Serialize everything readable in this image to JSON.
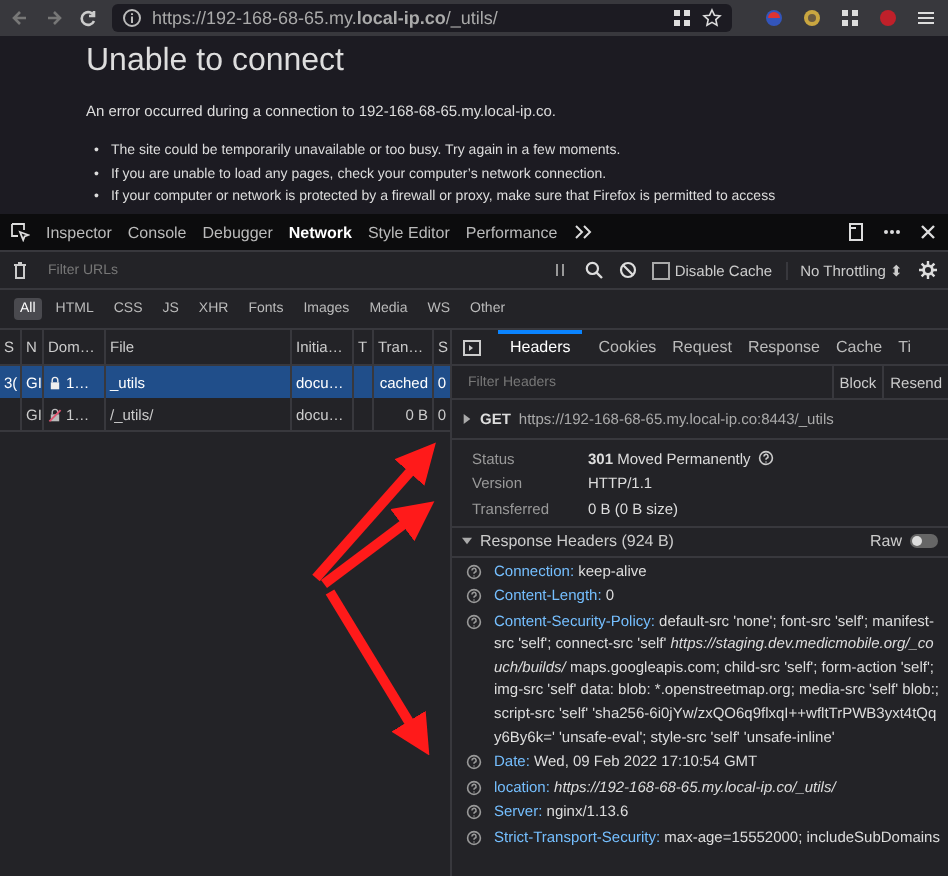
{
  "browser": {
    "url": "https://192-168-68-65.my.**local-ip.co**/_utils/"
  },
  "page": {
    "title": "Unable to connect",
    "message": "An error occurred during a connection to 192-168-68-65.my.local-ip.co.",
    "bullets": [
      {
        "marker": "•",
        "text": "The site could be temporarily unavailable or too busy. Try again in a few moments."
      },
      {
        "marker": "•",
        "text": "If you are unable to load any pages, check your computer’s network connection."
      },
      {
        "marker": "•",
        "text": "If your computer or network is protected by a firewall or proxy, make sure that Firefox is permitted to access"
      }
    ]
  },
  "devtools": {
    "tabs": [
      {
        "label": "Inspector",
        "selected": false
      },
      {
        "label": "Console",
        "selected": false
      },
      {
        "label": "Debugger",
        "selected": false
      },
      {
        "label": "Network",
        "selected": true
      },
      {
        "label": "Style Editor",
        "selected": false
      },
      {
        "label": "Performance",
        "selected": false
      }
    ],
    "filter": {
      "placeholder": "Filter URLs"
    },
    "disable_cache": {
      "label": "Disable Cache",
      "checked": false
    },
    "throttling": "No Throttling ⬍",
    "types": [
      {
        "label": "All",
        "selected": true
      },
      {
        "label": "HTML",
        "selected": false
      },
      {
        "label": "CSS",
        "selected": false
      },
      {
        "label": "JS",
        "selected": false
      },
      {
        "label": "XHR",
        "selected": false
      },
      {
        "label": "Fonts",
        "selected": false
      },
      {
        "label": "Images",
        "selected": false
      },
      {
        "label": "Media",
        "selected": false
      },
      {
        "label": "WS",
        "selected": false
      },
      {
        "label": "Other",
        "selected": false
      }
    ],
    "table": {
      "columns": [
        "S",
        "N",
        "Dom…",
        "File",
        "Initia…",
        "T",
        "Tran…",
        "S"
      ],
      "rows": [
        {
          "status": "3(",
          "method": "GI",
          "secure": true,
          "domain": "1…",
          "file": "_utils",
          "initiator": "docu…",
          "transferred": "cached",
          "size": "0",
          "selected": true
        },
        {
          "status": "",
          "method": "GI",
          "secure": false,
          "domain": "1…",
          "file": "/_utils/",
          "initiator": "docu…",
          "transferred": "0 B",
          "size": "0",
          "selected": false
        }
      ]
    },
    "details": {
      "tabs": [
        {
          "label": "Headers",
          "selected": true
        },
        {
          "label": "Cookies",
          "selected": false
        },
        {
          "label": "Request",
          "selected": false
        },
        {
          "label": "Response",
          "selected": false
        },
        {
          "label": "Cache",
          "selected": false
        },
        {
          "label": "Ti",
          "selected": false
        }
      ],
      "filter": {
        "placeholder": "Filter Headers"
      },
      "buttons": [
        "Block",
        "Resend"
      ],
      "request": {
        "method": "GET",
        "url": "https://192-168-68-65.my.local-ip.co:8443/_utils"
      },
      "summary": [
        {
          "label": "Status",
          "value": "**301** Moved Permanently",
          "help": true
        },
        {
          "label": "Version",
          "value": "HTTP/1.1",
          "help": false
        },
        {
          "label": "Transferred",
          "value": "0 B (0 B size)",
          "help": false
        }
      ],
      "response_headers": {
        "title": "Response Headers (924 B)",
        "raw": {
          "label": "Raw",
          "on": false
        },
        "items": [
          {
            "name": "Connection:",
            "value": "keep-alive",
            "italic": false
          },
          {
            "name": "Content-Length:",
            "value": "0",
            "italic": false
          },
          {
            "name": "Content-Security-Policy:",
            "value": "default-src 'none'; font-src 'self'; manifest-src 'self'; connect-src 'self' *https://staging.dev.medicmobile.org/_couch/builds/* maps.googleapis.com; child-src 'self'; form-action 'self'; img-src 'self' data: blob: *.openstreetmap.org; media-src 'self' blob:; script-src 'self' 'sha256-6i0jYw/zxQO6q9flxqI++wfltTrPWB3yxt4tQqy6By6k=' 'unsafe-eval'; style-src 'self' 'unsafe-inline'",
            "italic": false
          },
          {
            "name": "Date:",
            "value": "Wed, 09 Feb 2022 17:10:54 GMT",
            "italic": false
          },
          {
            "name": "location:",
            "value": "https://192-168-68-65.my.local-ip.co/_utils/",
            "italic": true
          },
          {
            "name": "Server:",
            "value": "nginx/1.13.6",
            "italic": false
          },
          {
            "name": "Strict-Transport-Security:",
            "value": "max-age=15552000; includeSubDomains",
            "italic": false
          }
        ]
      }
    }
  }
}
